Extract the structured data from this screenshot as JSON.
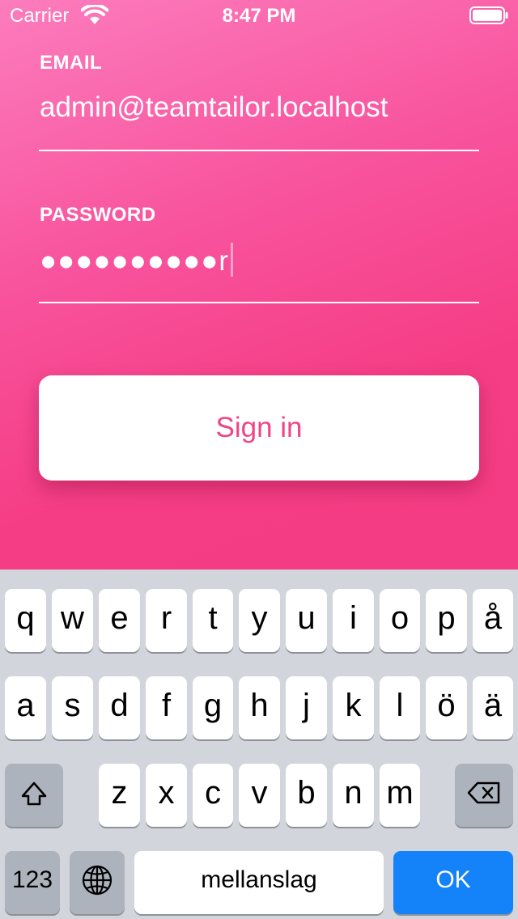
{
  "status_bar": {
    "carrier": "Carrier",
    "time": "8:47 PM"
  },
  "form": {
    "email": {
      "label": "EMAIL",
      "value": "admin@teamtailor.localhost"
    },
    "password": {
      "label": "PASSWORD",
      "masked_value": "●●●●●●●●●●r"
    },
    "sign_in_label": "Sign in"
  },
  "keyboard": {
    "row1": [
      "q",
      "w",
      "e",
      "r",
      "t",
      "y",
      "u",
      "i",
      "o",
      "p",
      "å"
    ],
    "row2": [
      "a",
      "s",
      "d",
      "f",
      "g",
      "h",
      "j",
      "k",
      "l",
      "ö",
      "ä"
    ],
    "row3": [
      "z",
      "x",
      "c",
      "v",
      "b",
      "n",
      "m"
    ],
    "numbers_label": "123",
    "space_label": "mellanslag",
    "return_label": "OK",
    "shift_icon": "shift-icon",
    "backspace_icon": "backspace-icon",
    "globe_icon": "globe-icon"
  },
  "colors": {
    "accent_pink": "#f53d85",
    "button_text": "#ee4587",
    "keyboard_return": "#1482f8"
  }
}
